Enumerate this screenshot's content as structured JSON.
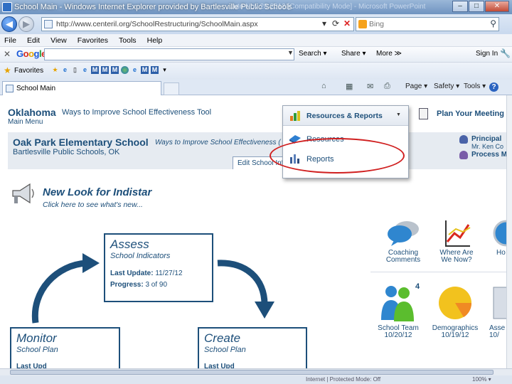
{
  "window": {
    "title": "School Main - Windows Internet Explorer provided by Bartlesville Public Schools",
    "ghost_title": "...ute Nov 28 2012 [Compatibility Mode] - Microsoft PowerPoint",
    "minimize": "–",
    "maximize": "□",
    "close": "✕"
  },
  "address": {
    "url": "http://www.centeril.org/SchoolRestructuring/SchoolMain.aspx",
    "search_placeholder": "Bing"
  },
  "menu": [
    "File",
    "Edit",
    "View",
    "Favorites",
    "Tools",
    "Help"
  ],
  "google_toolbar": {
    "close": "✕",
    "logo": [
      "G",
      "o",
      "o",
      "g",
      "l",
      "e"
    ],
    "search_label": "Search ▾",
    "share_label": "Share ▾",
    "more_label": "More ≫",
    "signin_label": "Sign In",
    "wrench": "🔧"
  },
  "favorites": {
    "label": "Favorites",
    "star": "★"
  },
  "tab": {
    "label": "School Main"
  },
  "command_bar": {
    "page": "Page ▾",
    "safety": "Safety ▾",
    "tools": "Tools ▾",
    "help": "?"
  },
  "page": {
    "brand": "Oklahoma",
    "brand_sub": "Ways to Improve School Effectiveness Tool",
    "main_menu": "Main Menu",
    "school_name": "Oak Park Elementary School",
    "school_sub": "Ways to Improve School Effectiveness (",
    "district": "Bartlesville Public Schools, OK",
    "edit_tab": "Edit School Information",
    "plan_meeting": "Plan Your Meeting",
    "principal_label": "Principal",
    "principal_name": "Mr. Ken Co",
    "process_label": "Process M",
    "new_look": "New Look for Indistar",
    "click_here": "Click here to see what's new...",
    "dropdown": {
      "header": "Resources & Reports",
      "items": [
        "Resources",
        "Reports"
      ]
    },
    "assess": {
      "title": "Assess",
      "subtitle": "School Indicators",
      "last_update_label": "Last Update:",
      "last_update_value": "11/27/12",
      "progress_label": "Progress:",
      "progress_value": "3 of 90"
    },
    "monitor": {
      "title": "Monitor",
      "subtitle": "School Plan",
      "cut": "Last Upd"
    },
    "create": {
      "title": "Create",
      "subtitle": "School Plan",
      "cut": "Last Upd"
    },
    "tiles_top": [
      {
        "label1": "Coaching",
        "label2": "Comments"
      },
      {
        "label1": "Where Are",
        "label2": "We Now?"
      },
      {
        "label1": "Ho",
        "label2": ""
      }
    ],
    "tiles_bottom": [
      {
        "label1": "School Team",
        "label2": "10/20/12"
      },
      {
        "label1": "Demographics",
        "label2": "10/19/12"
      },
      {
        "label1": "Asse",
        "label2": "10/"
      }
    ],
    "team_badge": "4"
  },
  "status": {
    "text": "Internet | Protected Mode: Off",
    "zoom": "100% ▾"
  }
}
